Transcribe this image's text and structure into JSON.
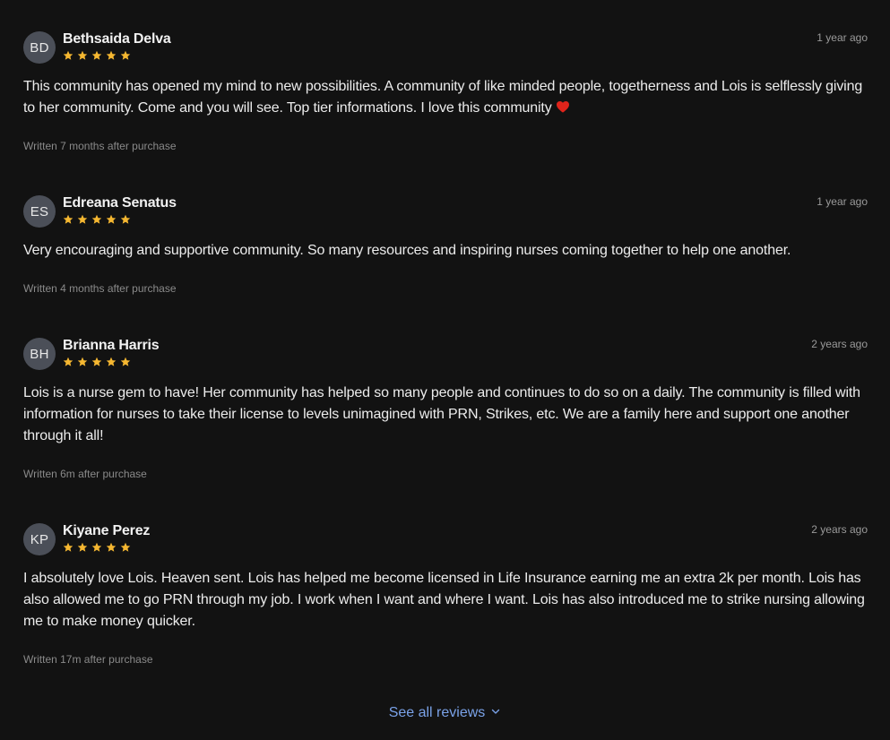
{
  "reviews": [
    {
      "initials": "BD",
      "name": "Bethsaida Delva",
      "rating": 5,
      "time": "1 year ago",
      "text": "This community has opened my mind to new possibilities. A community of like minded people, togetherness and Lois is selflessly giving to her community. Come and you will see. Top tier informations. I love this community",
      "emoji": "heart-icon",
      "written": "Written 7 months after purchase"
    },
    {
      "initials": "ES",
      "name": "Edreana Senatus",
      "rating": 5,
      "time": "1 year ago",
      "text": "Very encouraging and supportive community. So many resources and inspiring nurses coming together to help one another.",
      "written": "Written 4 months after purchase"
    },
    {
      "initials": "BH",
      "name": "Brianna Harris",
      "rating": 5,
      "time": "2 years ago",
      "text": "Lois is a nurse gem to have! Her community has helped so many people and continues to do so on a daily. The community is filled with information for nurses to take their license to levels unimagined with PRN, Strikes, etc. We are a family here and support one another through it all!",
      "written": "Written 6m after purchase"
    },
    {
      "initials": "KP",
      "name": "Kiyane Perez",
      "rating": 5,
      "time": "2 years ago",
      "text": "I absolutely love Lois. Heaven sent. Lois has helped me become licensed in Life Insurance earning me an extra 2k per month. Lois has also allowed me to go PRN through my job. I work when I want and where I want. Lois has also introduced me to strike nursing allowing me to make money quicker.",
      "written": "Written 17m after purchase"
    }
  ],
  "footer": {
    "see_all_label": "See all reviews",
    "icon": "chevron-down-icon"
  },
  "colors": {
    "background": "#121212",
    "star": "#f5b731",
    "link": "#7aa2e8",
    "heart": "#e0241b",
    "avatar": "#4b4f58"
  }
}
